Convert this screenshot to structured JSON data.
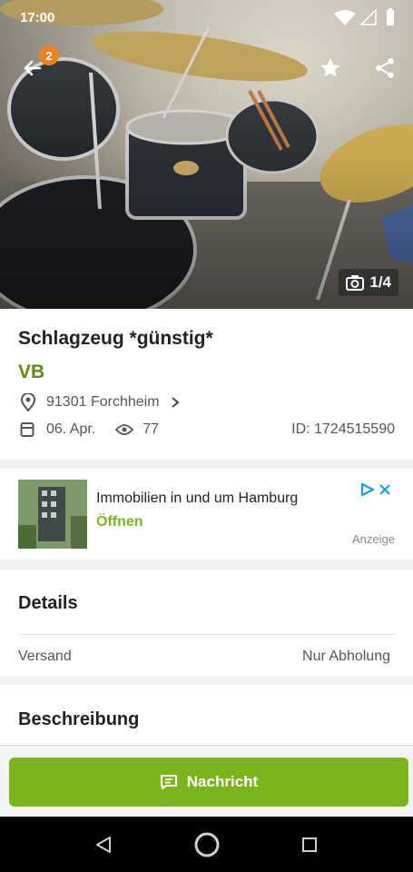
{
  "status_bar": {
    "time": "17:00"
  },
  "header": {
    "badge_count": "2",
    "photo_counter": "1/4"
  },
  "listing": {
    "title": "Schlagzeug *günstig*",
    "price": "VB",
    "location": "91301 Forchheim",
    "date": "06. Apr.",
    "views": "77",
    "id": "ID: 1724515590"
  },
  "ad": {
    "title": "Immobilien in und um Hamburg",
    "action": "Öffnen",
    "label": "Anzeige"
  },
  "details": {
    "heading": "Details",
    "rows": [
      {
        "label": "Versand",
        "value": "Nur Abholung"
      }
    ]
  },
  "description": {
    "heading": "Beschreibung"
  },
  "cta": {
    "label": "Nachricht"
  },
  "colors": {
    "brand_green": "#7ab51d",
    "price_green": "#5e8b16",
    "badge_orange": "#f1811f"
  }
}
